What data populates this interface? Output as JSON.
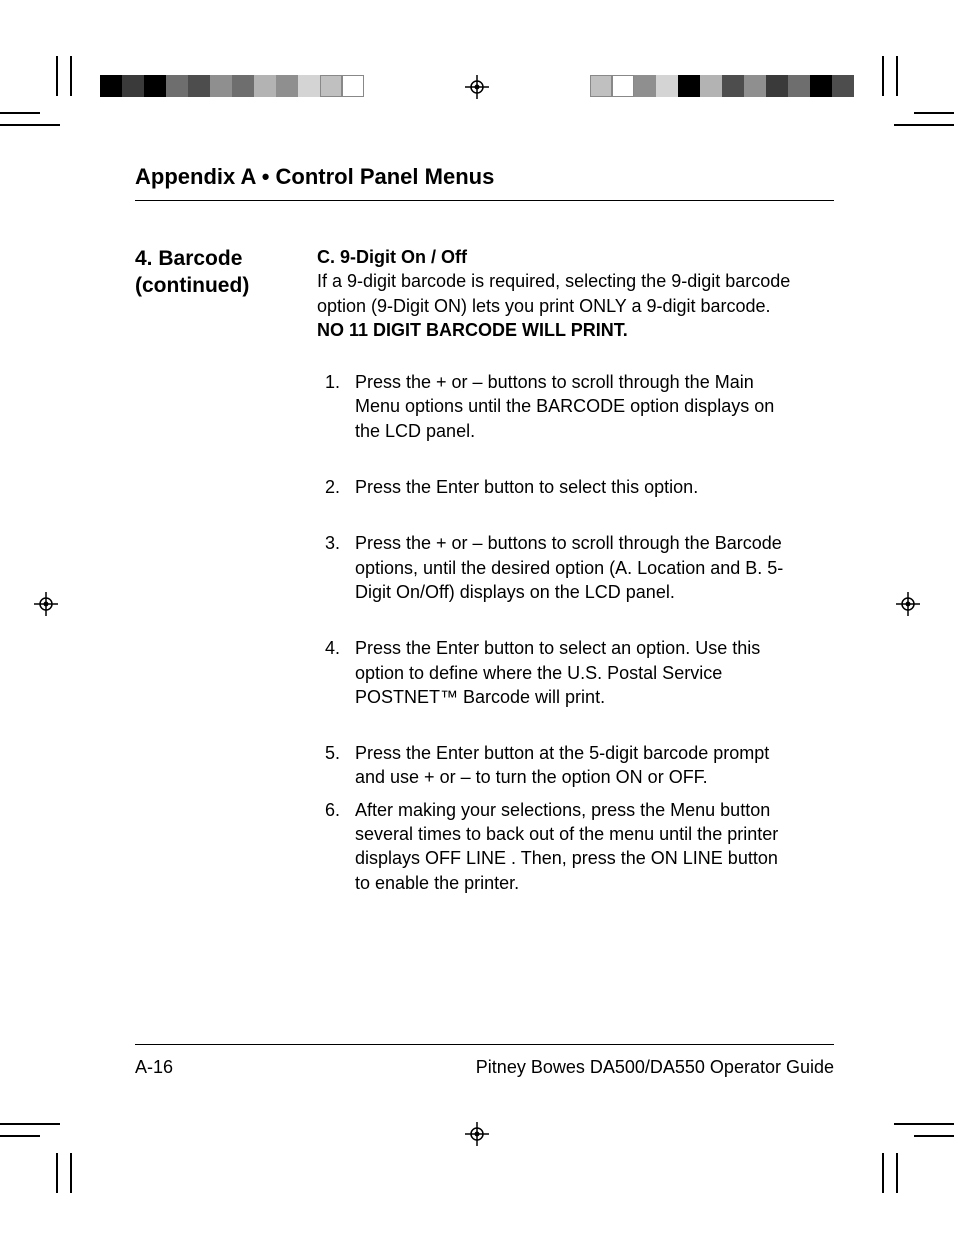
{
  "header": {
    "title": "Appendix A  •   Control Panel Menus"
  },
  "sideHeading": {
    "line1": "4.  Barcode",
    "line2": "(continued)"
  },
  "subsection": {
    "label": "C.  9-Digit On / Off",
    "intro_part1": "If a 9-digit barcode is required, selecting the 9-digit barcode option (9-Digit ON) lets you print ONLY a 9-digit barcode. ",
    "intro_bold": "NO 11 DIGIT BARCODE WILL PRINT."
  },
  "steps": [
    "Press the + or – buttons to scroll through the Main Menu options until the BARCODE option displays on the LCD panel.",
    "Press the Enter button to select this option.",
    "Press the + or – buttons to scroll through the Barcode options, until the desired option (A. Location and B. 5-Digit On/Off) displays on the LCD panel.",
    "Press the Enter button to select an option. Use this option to define where the U.S. Postal Service POSTNET™ Barcode will print.",
    "Press the Enter button at the 5-digit barcode prompt and use + or – to turn the option ON or OFF.",
    "After making your selections, press the Menu button several times to back out of the menu until the printer displays OFF LINE . Then, press the ON LINE button to enable the printer."
  ],
  "footer": {
    "pageNumber": "A-16",
    "guide": "Pitney Bowes DA500/DA550 Operator Guide"
  },
  "colorbar": {
    "left": [
      "#000000",
      "#3a3a3a",
      "#000000",
      "#6e6e6e",
      "#4d4d4d",
      "#8f8f8f",
      "#6e6e6e",
      "#b3b3b3",
      "#8f8f8f",
      "#d4d4d4",
      "#c0c0c0",
      "#ffffff"
    ],
    "right": [
      "#c0c0c0",
      "#ffffff",
      "#8f8f8f",
      "#d4d4d4",
      "#000000",
      "#b3b3b3",
      "#4d4d4d",
      "#8f8f8f",
      "#3a3a3a",
      "#6e6e6e",
      "#000000",
      "#4d4d4d"
    ]
  }
}
